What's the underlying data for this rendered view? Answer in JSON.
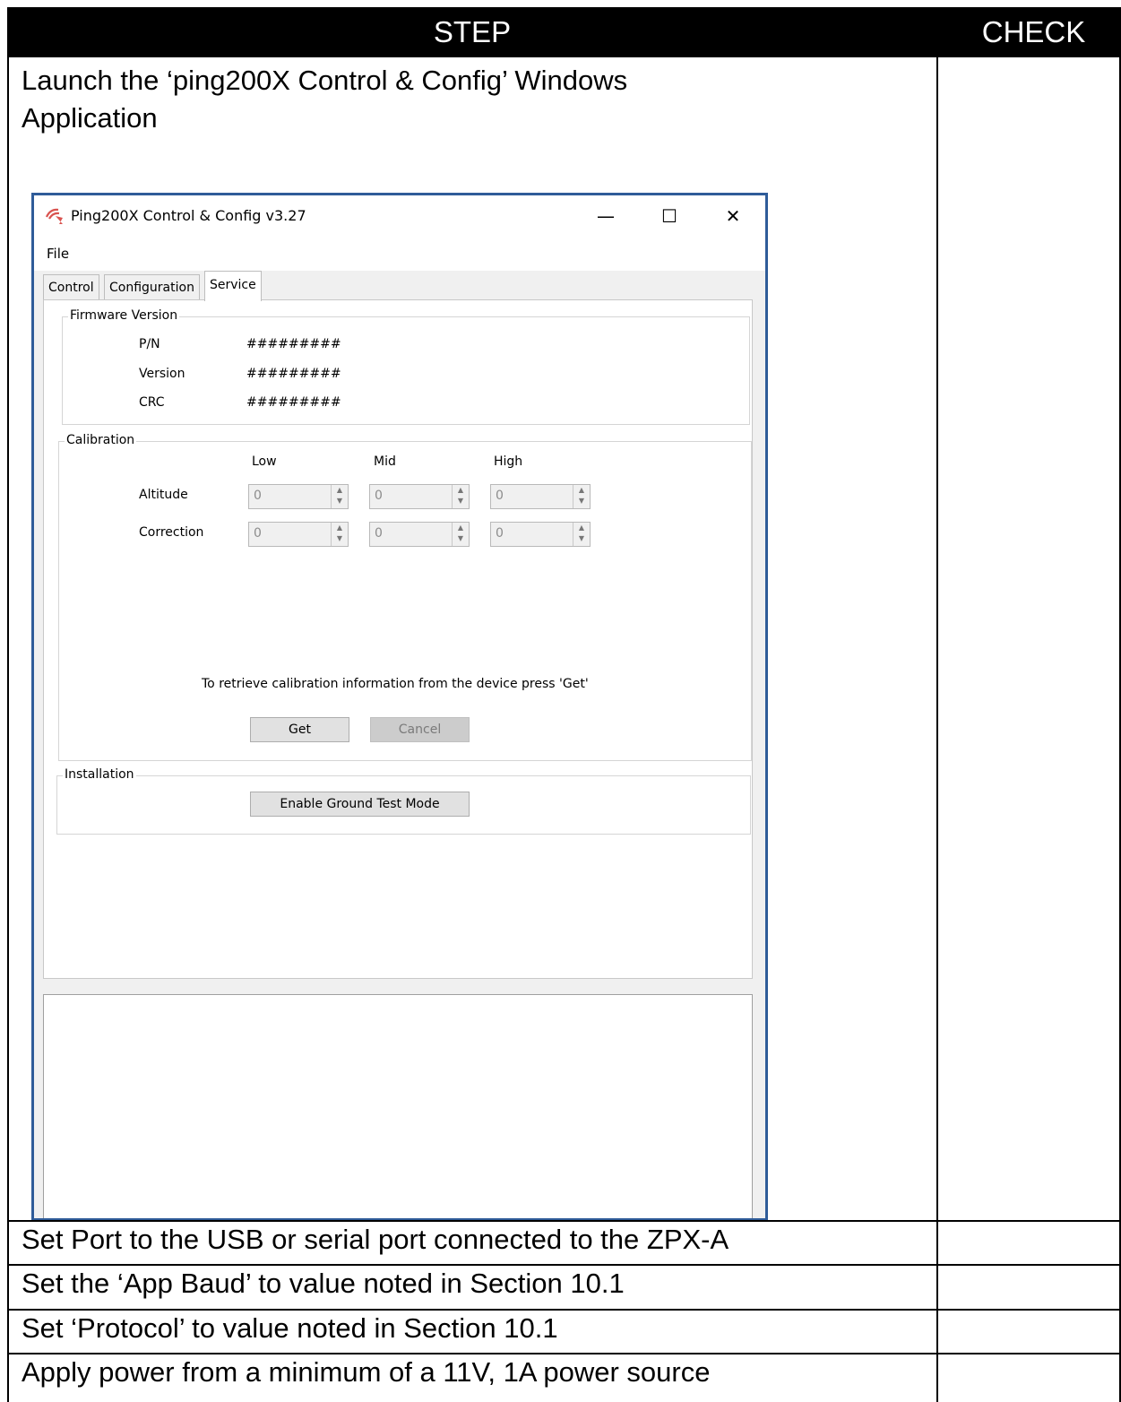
{
  "table": {
    "header_step": "STEP",
    "header_check": "CHECK",
    "rows": [
      "Launch the ‘ping200X Control & Config’ Windows Application",
      "Set Port to the USB or serial port connected to the ZPX-A",
      "Set the ‘App Baud’ to value noted in Section 10.1",
      "Set ‘Protocol’ to value noted in Section 10.1",
      "Apply power from a minimum of a 11V, 1A power source"
    ],
    "row1_line1": "Launch the ‘ping200X Control & Config’ Windows",
    "row1_line2": "Application"
  },
  "app": {
    "title": "Ping200X Control & Config v3.27",
    "menu_file": "File",
    "tabs": [
      "Control",
      "Configuration",
      "Service"
    ],
    "active_tab": "Service",
    "firmware": {
      "group_label": "Firmware Version",
      "rows": [
        {
          "label": "P/N",
          "value": "#########"
        },
        {
          "label": "Version",
          "value": "#########"
        },
        {
          "label": "CRC",
          "value": "#########"
        }
      ]
    },
    "calibration": {
      "group_label": "Calibration",
      "columns": [
        "Low",
        "Mid",
        "High"
      ],
      "rows": [
        {
          "label": "Altitude",
          "values": [
            "0",
            "0",
            "0"
          ]
        },
        {
          "label": "Correction",
          "values": [
            "0",
            "0",
            "0"
          ]
        }
      ],
      "info": "To retrieve calibration information from the device press 'Get'",
      "get_label": "Get",
      "cancel_label": "Cancel"
    },
    "installation": {
      "group_label": "Installation",
      "button_label": "Enable Ground Test Mode"
    },
    "colors": {
      "window_border": "#2f5c99",
      "icon": "#d9534f"
    }
  }
}
